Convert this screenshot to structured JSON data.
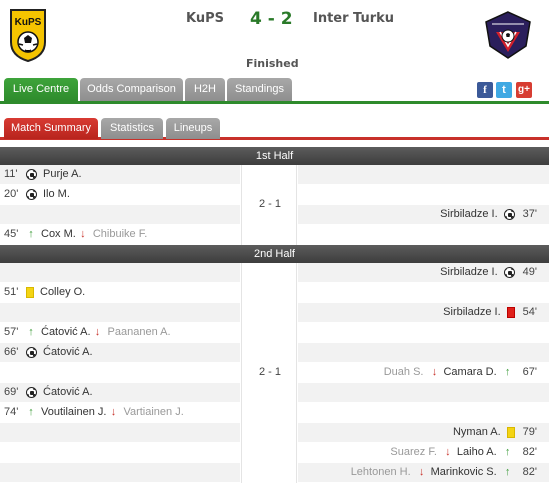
{
  "match": {
    "home_team": "KuPS",
    "away_team": "Inter Turku",
    "score": "4 - 2",
    "status": "Finished",
    "home_logo_text": "KuPS",
    "away_logo_text": "FC INTER TURKU"
  },
  "main_tabs": [
    {
      "label": "Live Centre",
      "active": true
    },
    {
      "label": "Odds Comparison",
      "active": false
    },
    {
      "label": "H2H",
      "active": false
    },
    {
      "label": "Standings",
      "active": false
    }
  ],
  "social": {
    "facebook": "f",
    "twitter": "t",
    "googleplus": "g+"
  },
  "sub_tabs": [
    {
      "label": "Match Summary",
      "active": true
    },
    {
      "label": "Statistics",
      "active": false
    },
    {
      "label": "Lineups",
      "active": false
    }
  ],
  "colors": {
    "green": "#2e8b2c",
    "red": "#c8312a",
    "yellow_card": "#f4d414",
    "red_card": "#e0201a"
  },
  "first_half": {
    "title": "1st Half",
    "score": "2 - 1",
    "events": [
      {
        "side": "home",
        "minute": "11'",
        "icon": "goal-ball-icon",
        "player": "Purje A.",
        "secondary": ""
      },
      {
        "side": "home",
        "minute": "20'",
        "icon": "goal-ball-icon",
        "player": "Ilo M.",
        "secondary": ""
      },
      {
        "side": "away",
        "minute": "37'",
        "icon": "goal-ball-icon",
        "player": "Sirbiladze I.",
        "secondary": ""
      },
      {
        "side": "home",
        "minute": "45'",
        "icon": "substitution-icon",
        "player": "Cox M.",
        "secondary": "Chibuike F."
      }
    ]
  },
  "second_half": {
    "title": "2nd Half",
    "score": "2 - 1",
    "events": [
      {
        "side": "away",
        "minute": "49'",
        "icon": "goal-ball-icon",
        "player": "Sirbiladze I.",
        "secondary": ""
      },
      {
        "side": "home",
        "minute": "51'",
        "icon": "yellow-card-icon",
        "player": "Colley O.",
        "secondary": ""
      },
      {
        "side": "away",
        "minute": "54'",
        "icon": "red-card-icon",
        "player": "Sirbiladze I.",
        "secondary": ""
      },
      {
        "side": "home",
        "minute": "57'",
        "icon": "substitution-icon",
        "player": "Ćatović A.",
        "secondary": "Paananen A."
      },
      {
        "side": "home",
        "minute": "66'",
        "icon": "goal-ball-icon",
        "player": "Ćatović A.",
        "secondary": ""
      },
      {
        "side": "away",
        "minute": "67'",
        "icon": "substitution-icon",
        "player": "Camara D.",
        "secondary": "Duah S."
      },
      {
        "side": "home",
        "minute": "69'",
        "icon": "goal-ball-icon",
        "player": "Ćatović A.",
        "secondary": ""
      },
      {
        "side": "home",
        "minute": "74'",
        "icon": "substitution-icon",
        "player": "Voutilainen J.",
        "secondary": "Vartiainen J."
      },
      {
        "side": "away",
        "minute": "79'",
        "icon": "yellow-card-icon",
        "player": "Nyman A.",
        "secondary": ""
      },
      {
        "side": "away",
        "minute": "82'",
        "icon": "substitution-icon",
        "player": "Laiho A.",
        "secondary": "Suarez F."
      },
      {
        "side": "away",
        "minute": "82'",
        "icon": "substitution-icon",
        "player": "Marinkovic S.",
        "secondary": "Lehtonen H."
      }
    ]
  }
}
